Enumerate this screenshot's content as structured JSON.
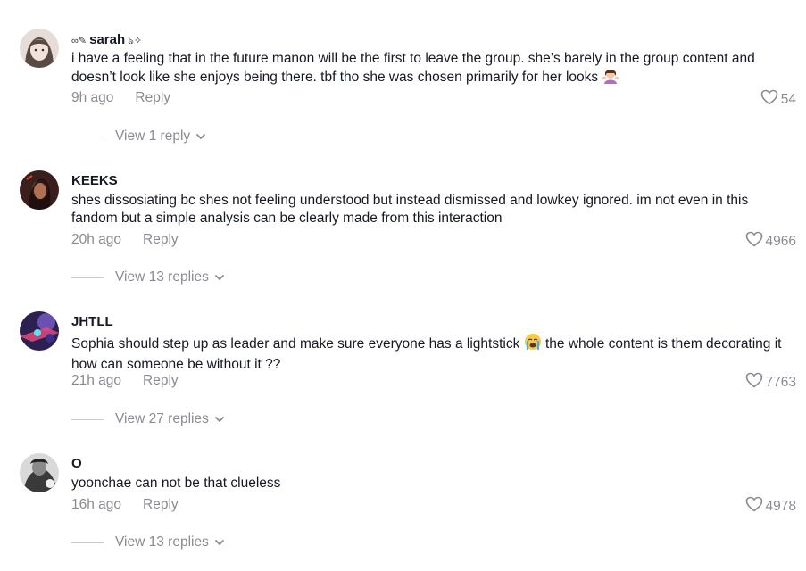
{
  "colors": {
    "text": "#161823",
    "muted": "#8a8b91",
    "background": "#ffffff"
  },
  "comments": [
    {
      "username": "sarah",
      "username_prefix": "∞",
      "username_suffix": "✧",
      "text": "i have a feeling that in the future manon will be the first to leave the group. she’s barely in the group content and doesn’t look like she enjoys being there. tbf tho she was chosen primarily for her looks",
      "emoji": "woman-gesturing-emoji",
      "time": "9h ago",
      "reply_label": "Reply",
      "likes": "54",
      "view_replies": "View 1 reply"
    },
    {
      "username": "KEEKS",
      "text": "shes dissosiating bc shes not feeling understood but instead dismissed and lowkey ignored. im not even in this fandom but a simple analysis can be clearly made from this interaction",
      "time": "20h ago",
      "reply_label": "Reply",
      "likes": "4966",
      "view_replies": "View 13 replies"
    },
    {
      "username": "JHTLL",
      "text_before_emoji": "Sophia should step up as leader and make sure everyone has a lightstick",
      "emoji": "crying-face-emoji",
      "text_after_emoji": "the whole content is them decorating it how can someone be without it ??",
      "time": "21h ago",
      "reply_label": "Reply",
      "likes": "7763",
      "view_replies": "View 27 replies"
    },
    {
      "username": "O",
      "text": "yoonchae can not be that clueless",
      "time": "16h ago",
      "reply_label": "Reply",
      "likes": "4978",
      "view_replies": "View 13 replies"
    }
  ]
}
